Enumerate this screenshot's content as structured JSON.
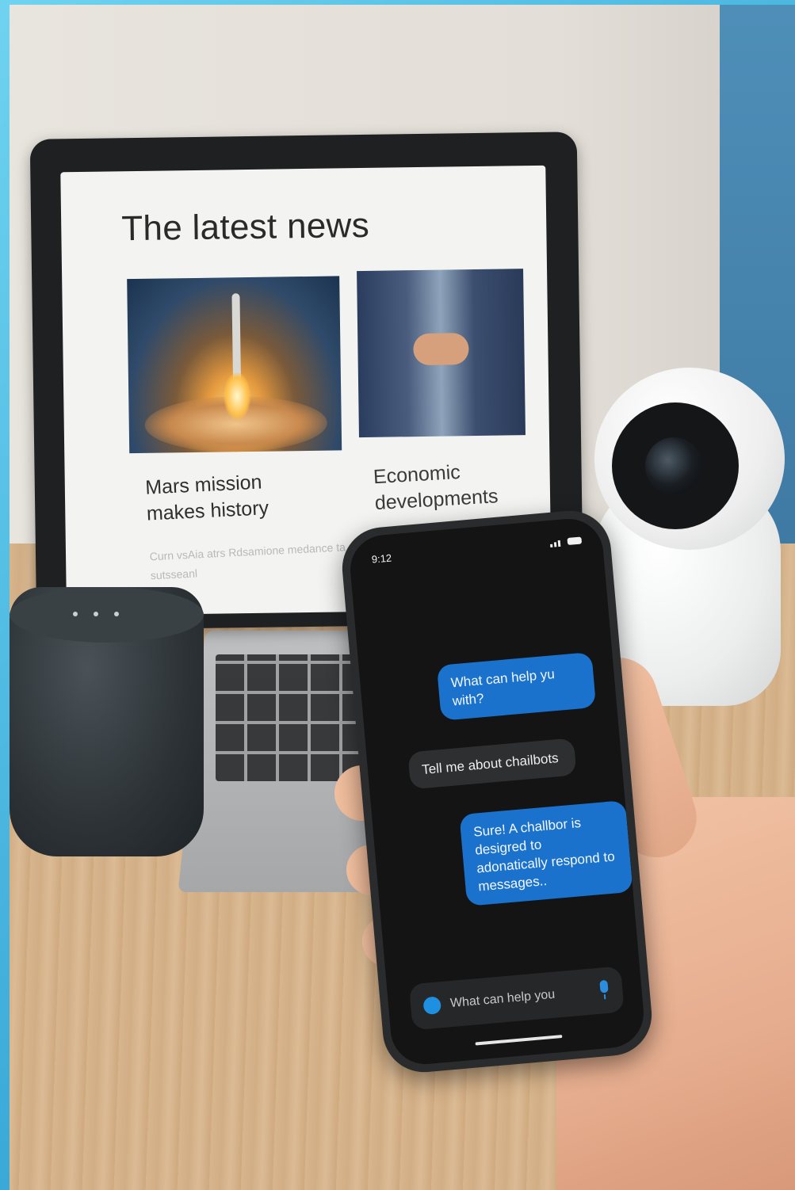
{
  "laptop_page": {
    "title": "The latest news",
    "articles": [
      {
        "headline": "Mars mission makes history",
        "snippet": "Curn vsAia atrs  Rdsamione medance ta sutsseanl"
      },
      {
        "headline": "Economic developments"
      }
    ]
  },
  "phone": {
    "status_time": "9:12",
    "messages": [
      {
        "direction": "outgoing",
        "text": "What can help yu with?"
      },
      {
        "direction": "incoming",
        "text": "Tell me about chailbots"
      },
      {
        "direction": "outgoing",
        "text": "Sure! A challbor is desigred to adonatically respond to messages.."
      }
    ],
    "compose": {
      "placeholder": "What can help you"
    },
    "colors": {
      "outgoing_bubble": "#1a72cc",
      "incoming_bubble": "#2e2f31",
      "screen_bg": "#141414"
    },
    "icons": {
      "compose": "chat-bubble-icon",
      "mic": "microphone-icon"
    }
  }
}
